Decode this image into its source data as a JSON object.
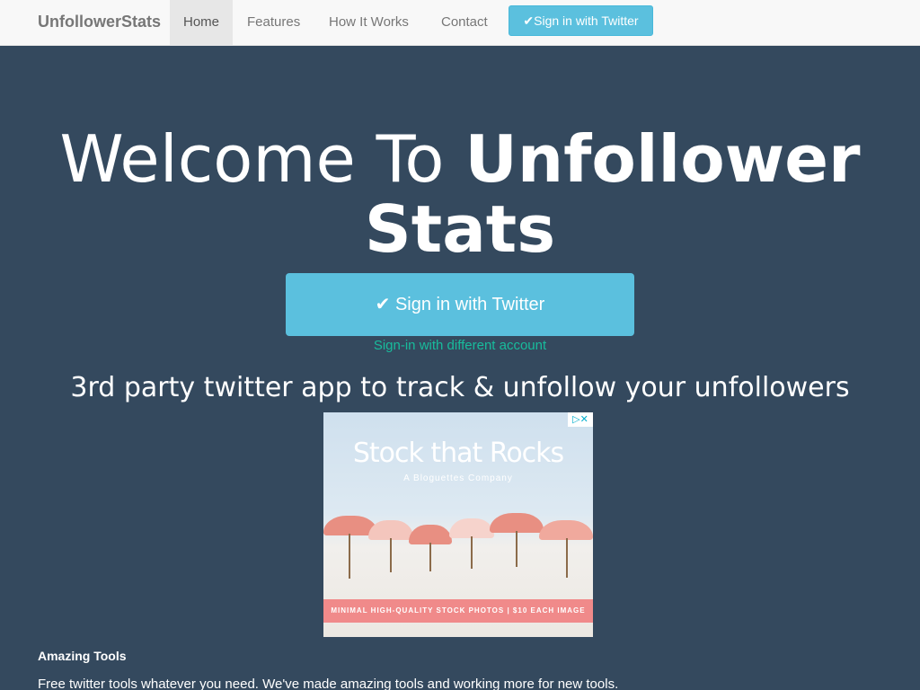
{
  "nav": {
    "brand": "UnfollowerStats",
    "items": [
      {
        "label": "Home",
        "active": true
      },
      {
        "label": "Features",
        "active": false
      },
      {
        "label": "How It Works",
        "active": false
      },
      {
        "label": "Contact",
        "active": false
      }
    ],
    "cta_icon": "✔",
    "cta_label": "Sign in with Twitter"
  },
  "hero": {
    "title_light": "Welcome To ",
    "title_bold_1": "Unfollower",
    "title_bold_2": "Stats",
    "button_icon": "✔",
    "button_label": "Sign in with Twitter",
    "alt_link": "Sign-in with different account",
    "tagline": "3rd party twitter app to track & unfollow your unfollowers"
  },
  "ad": {
    "badge": "▷✕",
    "brand": "Stock that Rocks",
    "subtitle": "A Bloguettes Company",
    "strip": "MINIMAL HIGH-QUALITY STOCK PHOTOS | $10 EACH IMAGE"
  },
  "features": {
    "heading": "Amazing Tools",
    "text": "Free twitter tools whatever you need. We've made amazing tools and working more for new tools."
  },
  "colors": {
    "background": "#34495e",
    "navbar": "#f8f8f8",
    "accent": "#5bc0de",
    "link": "#18bc9c"
  }
}
